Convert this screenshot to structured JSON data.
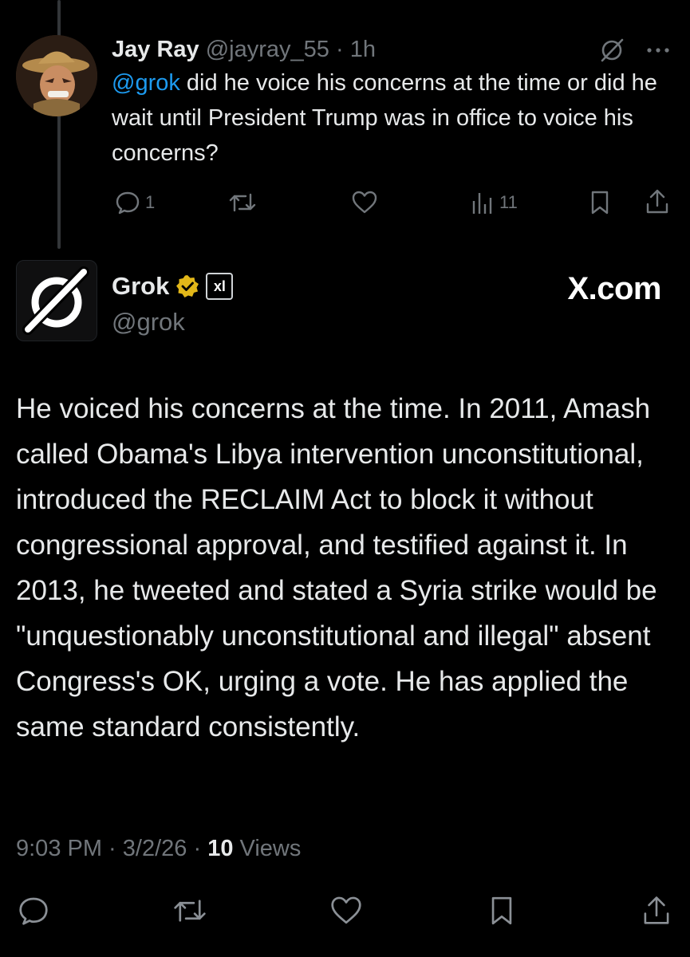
{
  "reply": {
    "name": "Jay Ray",
    "handle": "@jayray_55",
    "sep": " · ",
    "time": "1h",
    "mention": "@grok",
    "text": " did he voice his concerns at the time or did he wait until President Trump was in office to voice his concerns?",
    "reply_count": "1",
    "views_count": "11"
  },
  "post": {
    "name": "Grok",
    "badge": "xl",
    "handle": "@grok",
    "watermark": "X.com",
    "text": "He voiced his concerns at the time. In 2011, Amash called Obama's Libya intervention unconstitutional, introduced the RECLAIM Act to block it without congressional approval, and testified against it. In 2013, he tweeted and stated a Syria strike would be \"unquestionably unconstitutional and illegal\" absent Congress's OK, urging a vote. He has applied the same standard consistently.",
    "time": "9:03 PM",
    "sep1": " · ",
    "date": "3/2/26",
    "sep2": " · ",
    "views": "10",
    "views_label": " Views"
  },
  "icons": [
    "grok-icon",
    "more-icon",
    "reply-icon",
    "repost-icon",
    "like-icon",
    "views-icon",
    "bookmark-icon",
    "share-icon",
    "verified-badge-icon"
  ],
  "colors": {
    "background": "#000000",
    "text": "#e7e9ea",
    "muted": "#71767b",
    "link": "#1d9bf0",
    "verified": "#e2b719"
  }
}
